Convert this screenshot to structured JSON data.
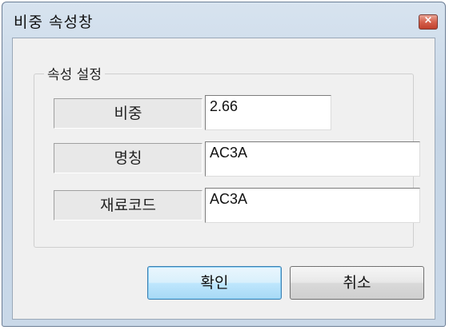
{
  "window": {
    "title": "비중 속성창",
    "close_symbol": "×"
  },
  "group": {
    "label": "속성 설정"
  },
  "fields": [
    {
      "label": "비중",
      "value": "2.66"
    },
    {
      "label": "명칭",
      "value": "AC3A"
    },
    {
      "label": "재료코드",
      "value": "AC3A"
    }
  ],
  "buttons": {
    "ok_label": "확인",
    "cancel_label": "취소"
  }
}
